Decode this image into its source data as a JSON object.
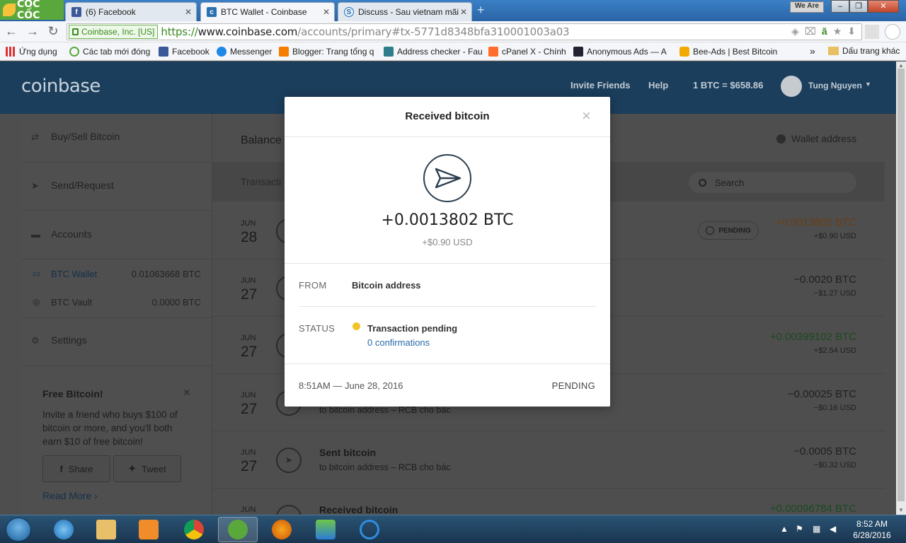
{
  "browser": {
    "brand": "CỐC CỐC",
    "tabs": [
      {
        "label": "(6) Facebook",
        "icon": "facebook-icon"
      },
      {
        "label": "BTC Wallet - Coinbase",
        "icon": "coinbase-icon"
      },
      {
        "label": "Discuss - Sau vietnam mãi",
        "icon": "discuss-icon"
      }
    ],
    "window_label": "We Are",
    "ev_badge": "Coinbase, Inc. [US]",
    "url": {
      "proto": "https://",
      "host": "www.coinbase.com",
      "path": "/accounts/primary#tx-5771d8348bfa310001003a03"
    },
    "bookmarks": [
      {
        "label": "Ứng dụng",
        "icon": "apps-icon"
      },
      {
        "label": "Các tab mới đóng",
        "icon": "recent-tabs-icon"
      },
      {
        "label": "Facebook",
        "icon": "facebook-icon"
      },
      {
        "label": "Messenger",
        "icon": "messenger-icon"
      },
      {
        "label": "Blogger: Trang tổng q",
        "icon": "blogger-icon"
      },
      {
        "label": "Address checker - Fau",
        "icon": "address-checker-icon"
      },
      {
        "label": "cPanel X - Chính",
        "icon": "cpanel-icon"
      },
      {
        "label": "Anonymous Ads — A",
        "icon": "anonymous-ads-icon"
      },
      {
        "label": "Bee-Ads | Best Bitcoin",
        "icon": "bee-ads-icon"
      }
    ],
    "bookmarks_more": "»",
    "bookmarks_folder": "Dấu trang khác"
  },
  "header": {
    "logo": "coinbase",
    "invite": "Invite Friends",
    "help": "Help",
    "price": "1 BTC = $658.86",
    "user": "Tung Nguyen"
  },
  "sidebar": {
    "items": [
      {
        "label": "Buy/Sell Bitcoin",
        "icon": "shuffle-icon"
      },
      {
        "label": "Send/Request",
        "icon": "send-icon"
      },
      {
        "label": "Accounts",
        "icon": "folder-icon"
      },
      {
        "label": "Settings",
        "icon": "gear-icon"
      }
    ],
    "wallets": [
      {
        "label": "BTC Wallet",
        "amount": "0.01063668 BTC",
        "icon": "wallet-icon"
      },
      {
        "label": "BTC Vault",
        "amount": "0.0000 BTC",
        "icon": "vault-icon"
      }
    ],
    "promo": {
      "title": "Free Bitcoin!",
      "text": "Invite a friend who buys $100 of bitcoin or more, and you'll both earn $10 of free bitcoin!",
      "share": "Share",
      "tweet": "Tweet",
      "read_more": "Read More ›"
    }
  },
  "main": {
    "balance_label": "Balance",
    "wallet_address": "Wallet address",
    "transactions_label": "Transacti",
    "search_placeholder": "Search",
    "pending_badge": "PENDING",
    "rows": [
      {
        "mon": "JUN",
        "day": "28",
        "name": "",
        "sub": "",
        "amount": "+0.0013802 BTC",
        "usd": "+$0.90 USD"
      },
      {
        "mon": "JUN",
        "day": "27",
        "name": "",
        "sub": "",
        "amount": "−0.0020 BTC",
        "usd": "−$1.27 USD"
      },
      {
        "mon": "JUN",
        "day": "27",
        "name": "",
        "sub": "",
        "amount": "+0.00399102 BTC",
        "usd": "+$2.54 USD"
      },
      {
        "mon": "JUN",
        "day": "27",
        "name": "",
        "sub": "to bitcoin address – RCB cho bác",
        "amount": "−0.00025 BTC",
        "usd": "−$0.16 USD"
      },
      {
        "mon": "JUN",
        "day": "27",
        "name": "Sent bitcoin",
        "sub": "to bitcoin address – RCB cho bác",
        "amount": "−0.0005 BTC",
        "usd": "−$0.32 USD"
      },
      {
        "mon": "JUN",
        "day": "",
        "name": "Received bitcoin",
        "sub": "",
        "amount": "+0.00096784 BTC",
        "usd": ""
      }
    ]
  },
  "modal": {
    "title": "Received bitcoin",
    "close": "×",
    "amount": "+0.0013802 BTC",
    "usd": "+$0.90 USD",
    "from_label": "FROM",
    "from_value": "Bitcoin address",
    "status_label": "STATUS",
    "status_value": "Transaction pending",
    "confirmations": "0 confirmations",
    "time": "8:51AM — June 28, 2016",
    "state": "PENDING"
  },
  "taskbar": {
    "time": "8:52 AM",
    "date": "6/28/2016"
  }
}
